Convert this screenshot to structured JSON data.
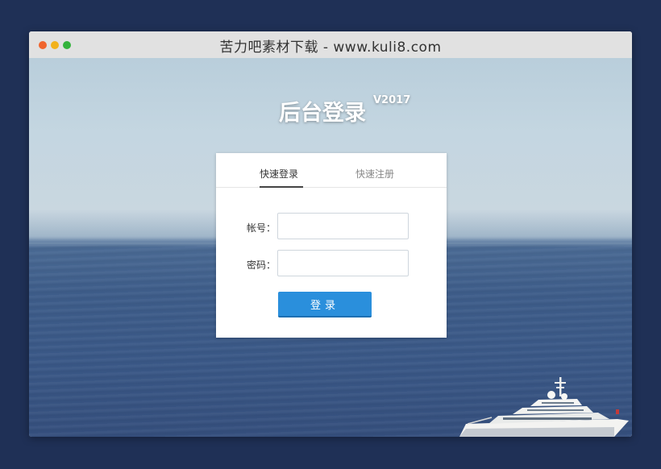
{
  "window": {
    "title": "苦力吧素材下载 - www.kuli8.com"
  },
  "header": {
    "title": "后台登录",
    "version": "V2017"
  },
  "login_panel": {
    "tabs": [
      {
        "label": "快速登录",
        "active": true
      },
      {
        "label": "快速注册",
        "active": false
      }
    ],
    "username_label": "帐号：",
    "username_value": "",
    "password_label": "密码：",
    "password_value": "",
    "submit_label": "登录"
  },
  "colors": {
    "page_background": "#1f3056",
    "button": "#2a8fdc",
    "window_dot_red": "#f0642d",
    "window_dot_yellow": "#f2b21c",
    "window_dot_green": "#33b33c"
  }
}
